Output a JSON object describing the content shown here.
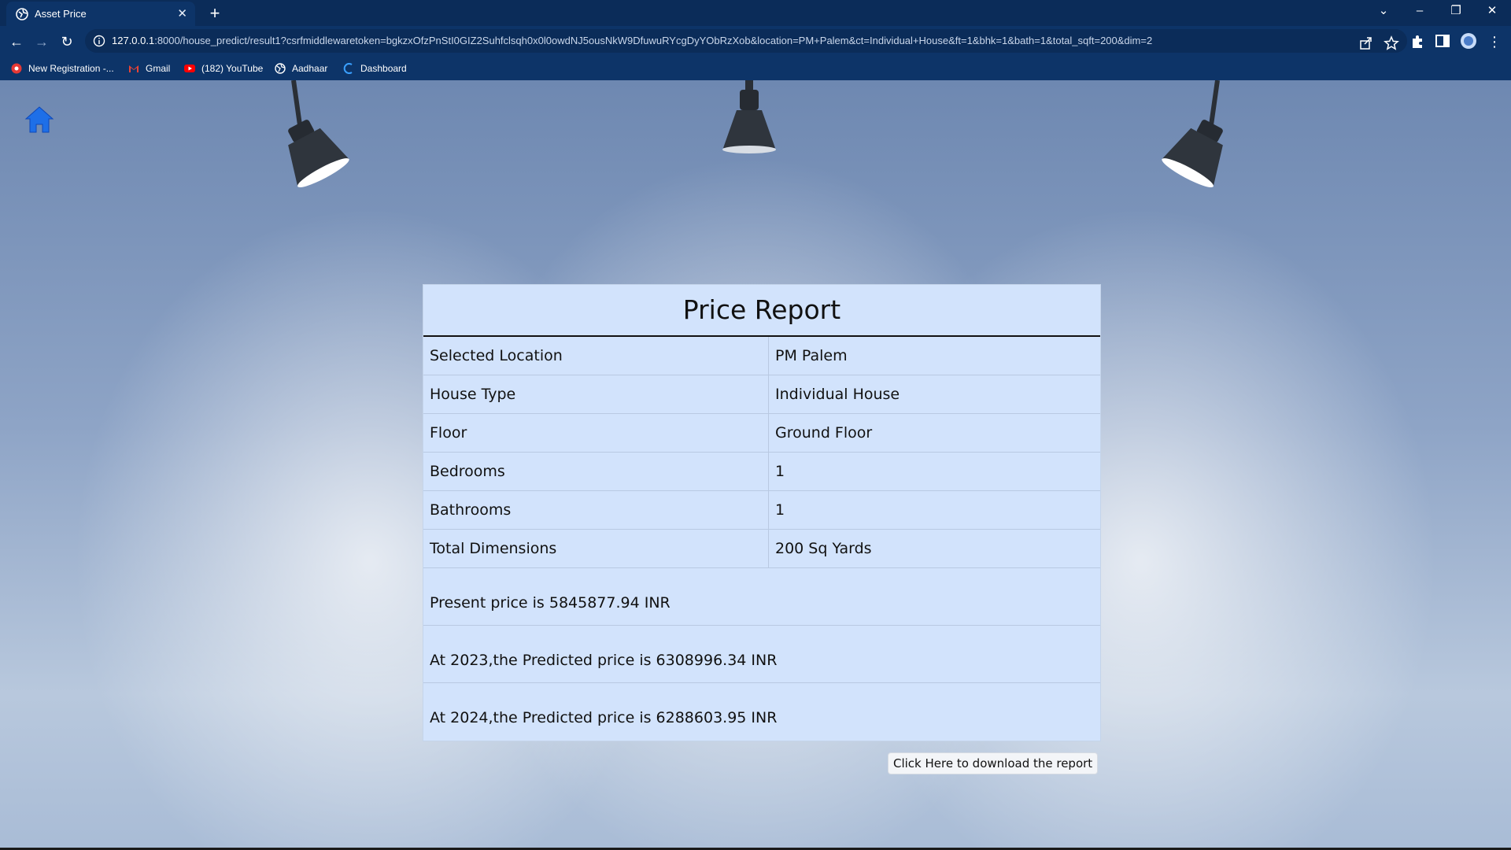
{
  "browser": {
    "tab_title": "Asset Price",
    "url_host": "127.0.0.1",
    "url_rest": ":8000/house_predict/result1?csrfmiddlewaretoken=bgkzxOfzPnStI0GIZ2Suhfclsqh0x0l0owdNJ5ousNkW9DfuwuRYcgDyYObRzXob&location=PM+Palem&ct=Individual+House&ft=1&bhk=1&bath=1&total_sqft=200&dim=2",
    "bookmarks": [
      {
        "label": "New Registration -...",
        "icon": "red-circle-icon"
      },
      {
        "label": "Gmail",
        "icon": "gmail-icon"
      },
      {
        "label": "(182) YouTube",
        "icon": "youtube-icon"
      },
      {
        "label": "Aadhaar",
        "icon": "globe-icon"
      },
      {
        "label": "Dashboard",
        "icon": "dashboard-icon"
      }
    ],
    "colors": {
      "frame": "#0d3468",
      "tabstrip": "#0b2c59"
    }
  },
  "report": {
    "title": "Price Report",
    "rows": [
      {
        "label": "Selected Location",
        "value": "PM Palem"
      },
      {
        "label": "House Type",
        "value": "Individual House"
      },
      {
        "label": "Floor",
        "value": "Ground Floor"
      },
      {
        "label": "Bedrooms",
        "value": "1"
      },
      {
        "label": "Bathrooms",
        "value": "1"
      },
      {
        "label": "Total Dimensions",
        "value": "200 Sq Yards"
      }
    ],
    "prices": [
      "Present price is 5845877.94 INR",
      "At 2023,the Predicted price is 6308996.34 INR",
      "At 2024,the Predicted price is 6288603.95 INR"
    ],
    "download_label": "Click Here to download the report",
    "colors": {
      "table_bg": "#d2e3fc",
      "home_icon": "#1e6fe8"
    }
  }
}
